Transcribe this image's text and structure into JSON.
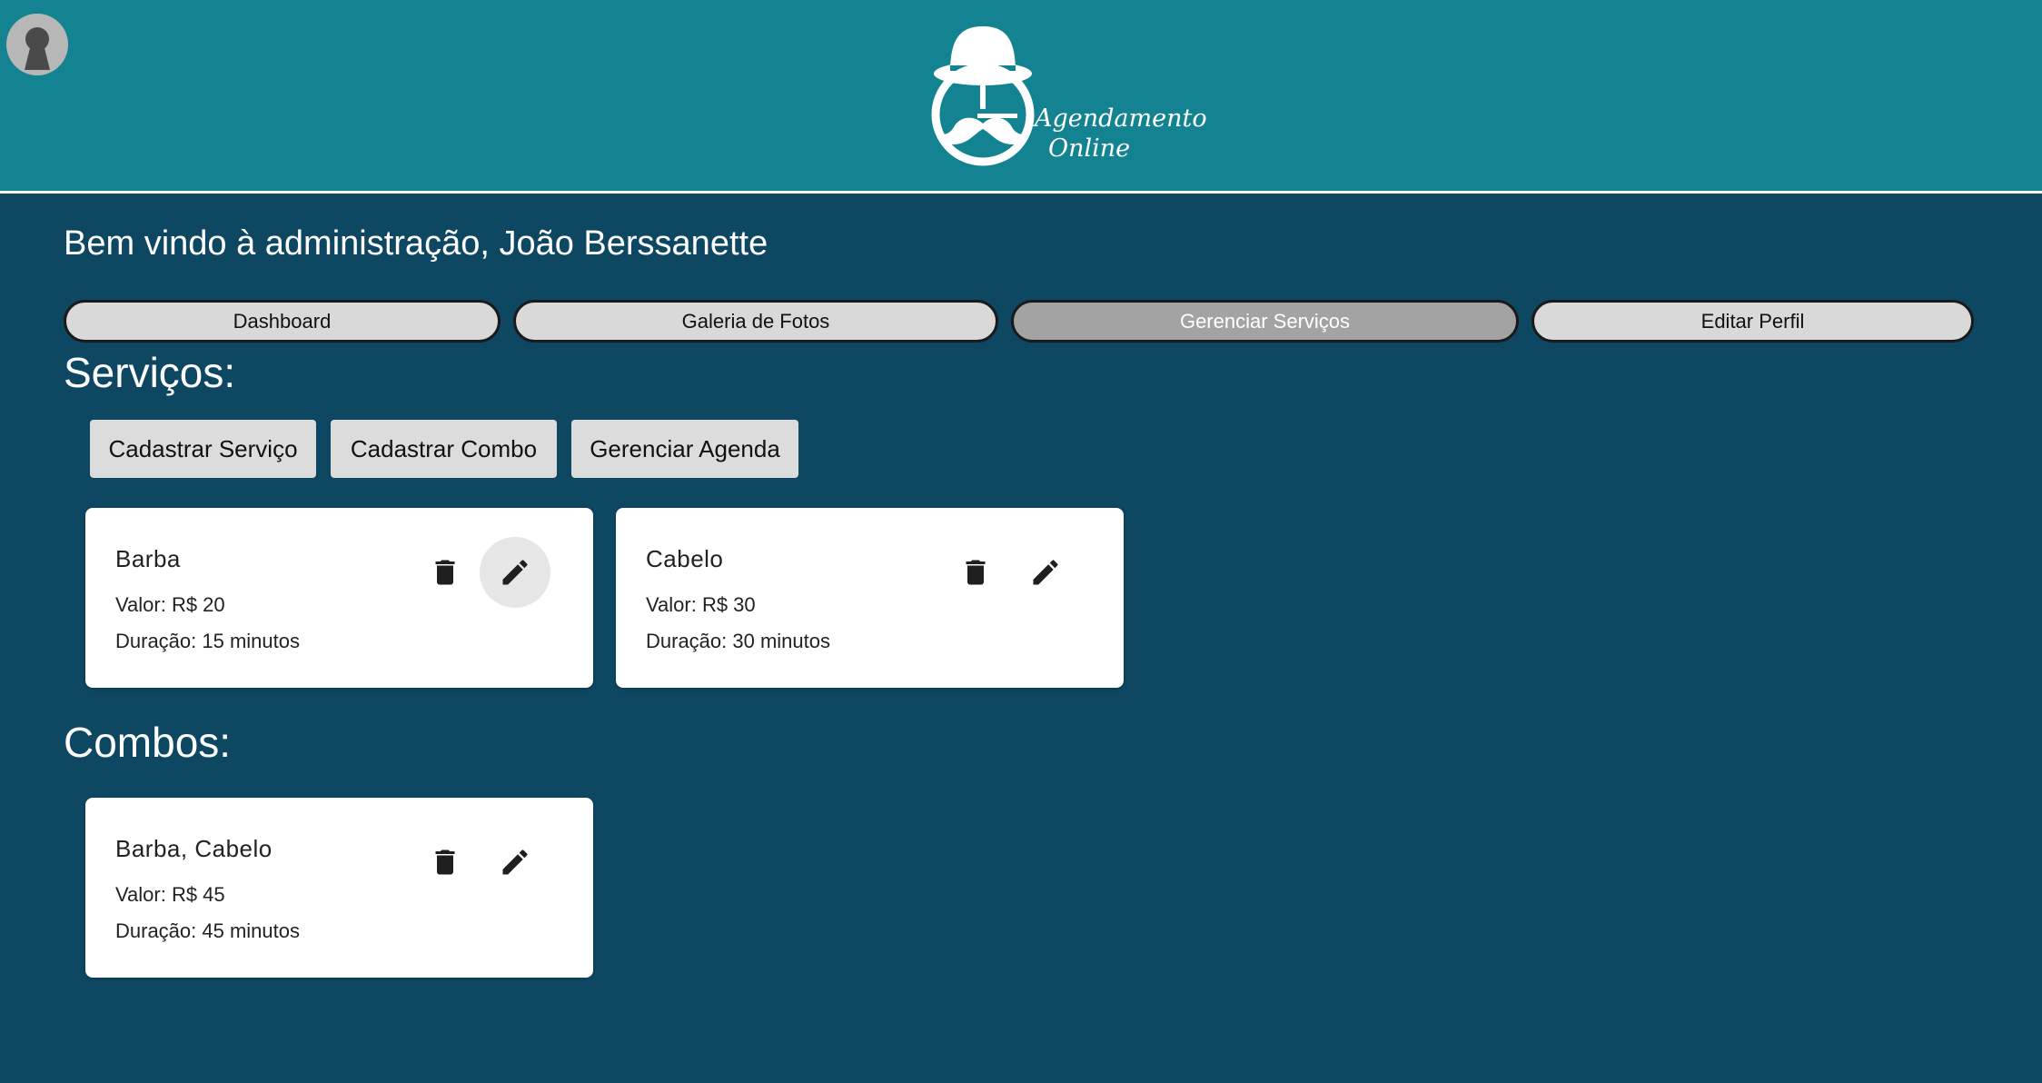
{
  "header": {
    "logo_line1": "Agendamento",
    "logo_line2": "Online",
    "avatar_icon": "user-avatar-icon",
    "colors": {
      "header_bg": "#138391",
      "page_bg": "#0e4762"
    }
  },
  "welcome": "Bem vindo à administração, João Berssanette",
  "nav": [
    {
      "label": "Dashboard",
      "active": false
    },
    {
      "label": "Galeria de Fotos",
      "active": false
    },
    {
      "label": "Gerenciar Serviços",
      "active": true
    },
    {
      "label": "Editar Perfil",
      "active": false
    }
  ],
  "services_title": "Serviços:",
  "actions": [
    {
      "label": "Cadastrar Serviço"
    },
    {
      "label": "Cadastrar Combo"
    },
    {
      "label": "Gerenciar Agenda"
    }
  ],
  "services": [
    {
      "name": "Barba",
      "valor": "Valor: R$ 20",
      "duracao": "Duração: 15 minutos"
    },
    {
      "name": "Cabelo",
      "valor": "Valor: R$ 30",
      "duracao": "Duração: 30 minutos"
    }
  ],
  "combos_title": "Combos:",
  "combos": [
    {
      "name": "Barba, Cabelo",
      "valor": "Valor: R$ 45",
      "duracao": "Duração: 45 minutos"
    }
  ],
  "icons": {
    "delete": "trash-icon",
    "edit": "pencil-icon"
  }
}
